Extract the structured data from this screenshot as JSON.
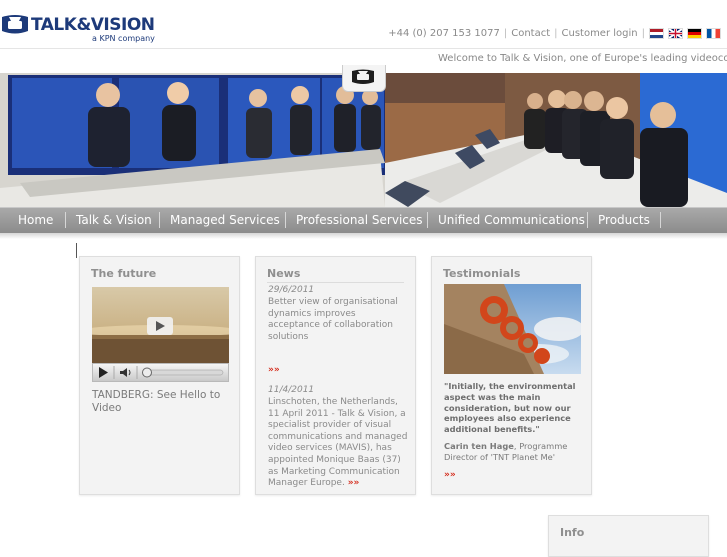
{
  "header": {
    "logo_title": "TALK&VISION",
    "logo_subtitle": "a KPN company",
    "phone": "+44 (0) 207 153 1077",
    "contact_label": "Contact",
    "login_label": "Customer login",
    "flags": [
      "nl-flag-icon",
      "uk-flag-icon",
      "de-flag-icon",
      "fr-flag-icon"
    ],
    "welcome_text": "Welcome to Talk & Vision, one of Europe's leading videoconfe"
  },
  "nav": {
    "items": [
      "Home",
      "Talk & Vision",
      "Managed Services",
      "Professional Services",
      "Unified Communications",
      "Products"
    ]
  },
  "future": {
    "title": "The future",
    "caption": "TANDBERG: See Hello to Video"
  },
  "news": {
    "title": "News",
    "items": [
      {
        "date": "29/6/2011",
        "text": "Better view of organisational dynamics improves acceptance of collaboration solutions",
        "more": "»»"
      },
      {
        "date": "11/4/2011",
        "text": "Linschoten, the Netherlands, 11 April 2011 - Talk & Vision, a specialist provider of visual communications and managed video services (MAVIS), has appointed Monique Baas (37) as Marketing Communication Manager Europe.",
        "more": "»»"
      }
    ]
  },
  "testimonials": {
    "title": "Testimonials",
    "quote": "\"Initially, the environmental aspect was the main consideration, but now our employees also experience additional benefits.\"",
    "author_name": "Carin ten Hage",
    "author_role": ", Programme Director of 'TNT Planet Me'",
    "more": "»»"
  },
  "info": {
    "title": "Info"
  },
  "colors": {
    "brand": "#1d3a7a",
    "accent_red": "#d42a1a",
    "nav_bg": "#9a9a9a"
  }
}
